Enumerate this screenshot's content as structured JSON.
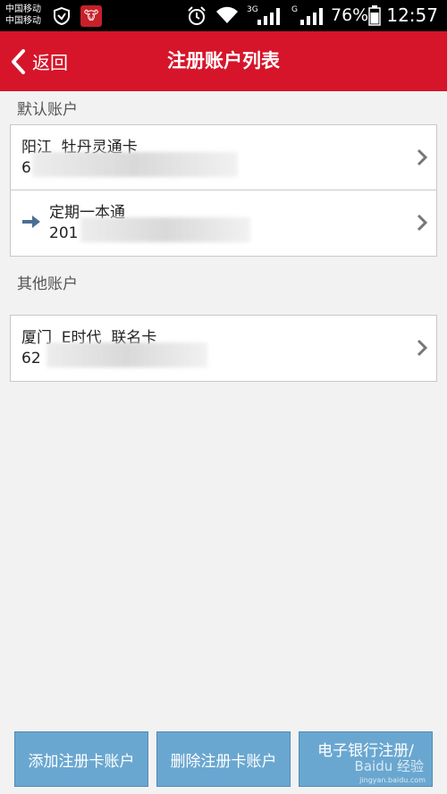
{
  "status_bar": {
    "carrier1": "中国移动",
    "carrier2": "中国移动",
    "net1": "3G",
    "net2": "G",
    "battery": "76%",
    "time": "12:57",
    "icons": [
      "shield-icon",
      "app-icon",
      "alarm-icon",
      "wifi-icon",
      "signal-icon",
      "signal-icon",
      "battery-icon"
    ]
  },
  "nav": {
    "back_label": "返回",
    "title": "注册账户列表"
  },
  "default_section": {
    "header": "默认账户",
    "accounts": [
      {
        "name": "阳江  牡丹灵通卡",
        "number": "6"
      },
      {
        "name": "定期一本通",
        "number": "201"
      }
    ]
  },
  "other_section": {
    "header": "其他账户",
    "accounts": [
      {
        "name": "厦门  E时代  联名卡",
        "number": "62"
      }
    ]
  },
  "buttons": {
    "add": "添加注册卡账户",
    "delete": "删除注册卡账户",
    "ebank": "电子银行注册/"
  },
  "watermark": {
    "text": "Baidu 经验",
    "sub": "jingyan.baidu.com"
  },
  "colors": {
    "nav_bg": "#d6152a",
    "button_bg": "#6aa7d0",
    "arrow": "#4a6f94"
  }
}
